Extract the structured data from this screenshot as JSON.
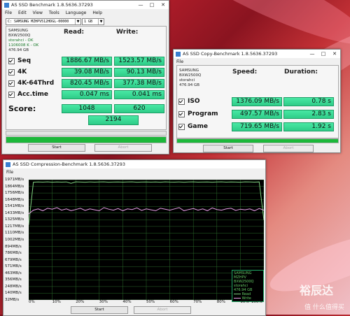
{
  "win1": {
    "title": "AS SSD Benchmark 1.8.5636.37293",
    "menu": [
      "File",
      "Edit",
      "View",
      "Tools",
      "Language",
      "Help"
    ],
    "drive_combo": "C: SAMSUNG MZHPV512HDGL-00000",
    "size_combo": "1 GB",
    "drive_info": [
      "SAMSUNG",
      "BXW2500Q",
      "storahci - OK",
      "1106008 K - OK",
      "476.94 GB"
    ],
    "col_read": "Read:",
    "col_write": "Write:",
    "rows": [
      {
        "label": "Seq",
        "read": "1886.67 MB/s",
        "write": "1523.57 MB/s"
      },
      {
        "label": "4K",
        "read": "39.08 MB/s",
        "write": "90.13 MB/s"
      },
      {
        "label": "4K-64Thrd",
        "read": "820.45 MB/s",
        "write": "377.38 MB/s"
      },
      {
        "label": "Acc.time",
        "read": "0.047 ms",
        "write": "0.041 ms"
      }
    ],
    "score_label": "Score:",
    "score_read": "1048",
    "score_write": "620",
    "score_total": "2194",
    "progress": 1.0,
    "start": "Start",
    "abort": "Abort"
  },
  "win2": {
    "title": "AS SSD Copy-Benchmark 1.8.5636.37293",
    "menu": [
      "File"
    ],
    "drive_info": [
      "SAMSUNG",
      "BXW2500Q",
      "storahci",
      "476.94 GB"
    ],
    "col_speed": "Speed:",
    "col_duration": "Duration:",
    "rows": [
      {
        "label": "ISO",
        "speed": "1376.09 MB/s",
        "duration": "0.78 s"
      },
      {
        "label": "Program",
        "speed": "497.57 MB/s",
        "duration": "2.83 s"
      },
      {
        "label": "Game",
        "speed": "719.65 MB/s",
        "duration": "1.92 s"
      }
    ],
    "progress": 1.0,
    "start": "Start",
    "abort": "Abort"
  },
  "win3": {
    "title": "AS SSD Compression-Benchmark 1.8.5636.37293",
    "menu": [
      "File"
    ],
    "start": "Start",
    "abort": "Abort",
    "legend": {
      "drive": [
        "SAMSUNG MZHPV",
        "BXW2500Q",
        "storahci",
        "476.94 GB"
      ],
      "read": "Read",
      "write": "Write",
      "read_color": "#7fd07f",
      "write_color": "#e8a0e8"
    }
  },
  "chart_data": {
    "type": "line",
    "x_ticks": [
      "0%",
      "10%",
      "20%",
      "30%",
      "40%",
      "50%",
      "60%",
      "70%",
      "80%",
      "90%",
      "100%"
    ],
    "y_ticks": [
      "1971MB/s",
      "1864MB/s",
      "1756MB/s",
      "1648MB/s",
      "1541MB/s",
      "1433MB/s",
      "1325MB/s",
      "1217MB/s",
      "1110MB/s",
      "1002MB/s",
      "894MB/s",
      "786MB/s",
      "679MB/s",
      "571MB/s",
      "463MB/s",
      "356MB/s",
      "248MB/s",
      "140MB/s",
      "32MB/s"
    ],
    "ylim": [
      32,
      1971
    ],
    "x": [
      0,
      2,
      4,
      6,
      8,
      10,
      12,
      14,
      16,
      18,
      20,
      22,
      24,
      26,
      28,
      30,
      32,
      34,
      36,
      38,
      40,
      42,
      44,
      46,
      48,
      50,
      52,
      54,
      56,
      58,
      60,
      62,
      64,
      66,
      68,
      70,
      72,
      74,
      76,
      78,
      80,
      82,
      84,
      86,
      88,
      90,
      92,
      94,
      96,
      98,
      100
    ],
    "series": [
      {
        "name": "Read",
        "color": "#7fd07f",
        "values": [
          1240,
          1930,
          1935,
          1932,
          1936,
          1930,
          1934,
          1931,
          1935,
          1912,
          1936,
          1933,
          1930,
          1935,
          1931,
          1934,
          1936,
          1930,
          1933,
          1935,
          1931,
          1934,
          1936,
          1930,
          1933,
          1935,
          1931,
          1934,
          1930,
          1936,
          1933,
          1931,
          1935,
          1930,
          1934,
          1936,
          1931,
          1933,
          1935,
          1930,
          1934,
          1936,
          1931,
          1935,
          1933,
          1930,
          1936,
          1934,
          1931,
          1935,
          1320
        ]
      },
      {
        "name": "Write",
        "color": "#e8a0e8",
        "values": [
          1420,
          1480,
          1500,
          1470,
          1510,
          1495,
          1520,
          1480,
          1500,
          1470,
          1490,
          1510,
          1475,
          1500,
          1485,
          1470,
          1520,
          1495,
          1480,
          1505,
          1470,
          1500,
          1490,
          1515,
          1475,
          1500,
          1485,
          1470,
          1510,
          1495,
          1480,
          1500,
          1520,
          1470,
          1490,
          1505,
          1480,
          1500,
          1470,
          1515,
          1490,
          1480,
          1500,
          1510,
          1475,
          1495,
          1485,
          1500,
          1470,
          1505,
          1480
        ]
      }
    ]
  },
  "watermark": {
    "text": "值 什么值得买",
    "brand": "裕辰达"
  }
}
